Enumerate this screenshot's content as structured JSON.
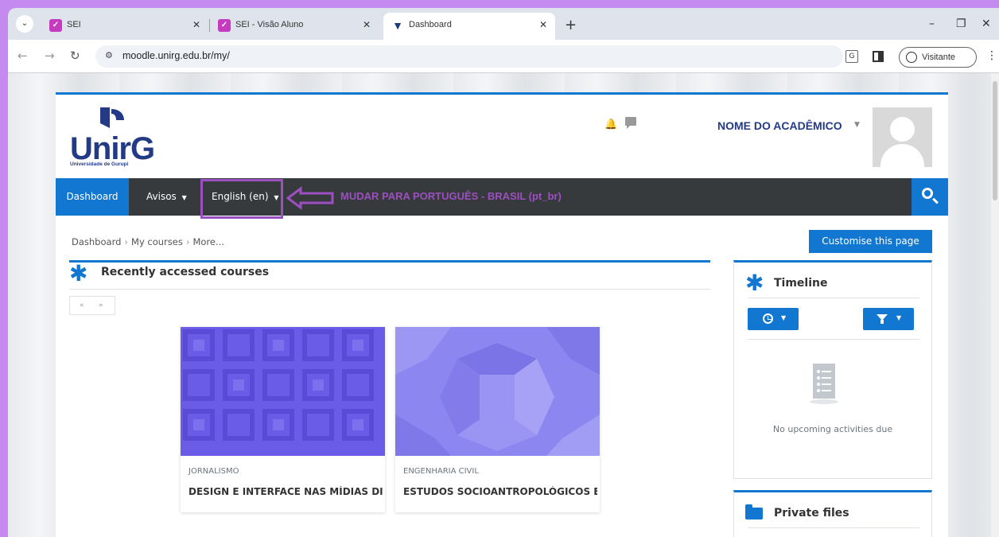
{
  "browser": {
    "tabs": [
      {
        "title": "SEI",
        "active": false
      },
      {
        "title": "SEI - Visão Aluno",
        "active": false
      },
      {
        "title": "Dashboard",
        "active": true
      }
    ],
    "url": "moodle.unirg.edu.br/my/",
    "profile_label": "Visitante"
  },
  "site": {
    "logo_text": "UnirG",
    "logo_sub": "Universidade de Gurupi",
    "user_name": "NOME DO ACADÊMICO"
  },
  "navbar": {
    "dashboard": "Dashboard",
    "avisos": "Avisos",
    "language": "English (en)",
    "annotation": "MUDAR PARA PORTUGUÊS - BRASIL (pt_br)"
  },
  "breadcrumb": [
    "Dashboard",
    "My courses",
    "More..."
  ],
  "customise_label": "Customise this page",
  "recent": {
    "title": "Recently accessed courses",
    "pager_prev": "«",
    "pager_next": "»",
    "courses": [
      {
        "category": "JORNALISMO",
        "name": "DESIGN E INTERFACE NAS MÍDIAS DIG",
        "color": "#6b5ce7"
      },
      {
        "category": "ENGENHARIA CIVIL",
        "name": "ESTUDOS SOCIOANTROPOLÓGICOS E",
        "color": "#8c86f0"
      }
    ]
  },
  "timeline": {
    "title": "Timeline",
    "empty_text": "No upcoming activities due"
  },
  "private_files": {
    "title": "Private files"
  },
  "colors": {
    "primary": "#1177d1",
    "navbar": "#373a3c",
    "brand": "#233a86",
    "annotation": "#9c4fc0"
  }
}
